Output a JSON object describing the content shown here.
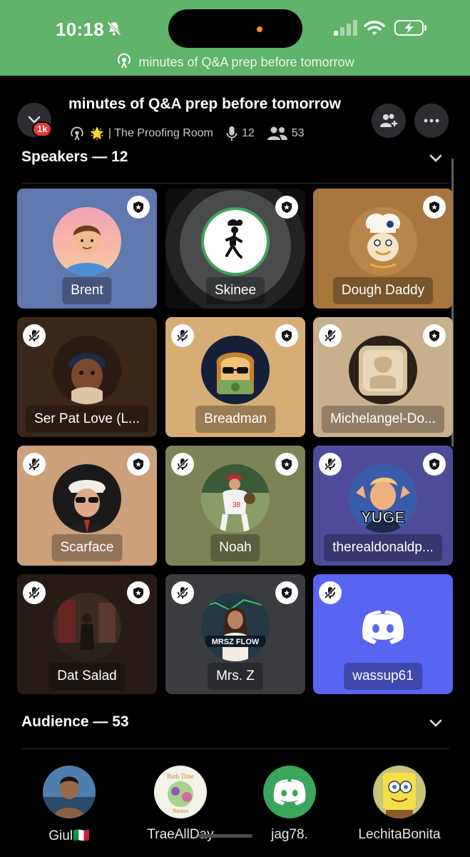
{
  "status_bar": {
    "time": "10:18",
    "banner_text": "minutes of Q&A prep before tomorrow",
    "background": "#5fb36a"
  },
  "header": {
    "badge": "1k",
    "title": "minutes of Q&A prep before tomorrow",
    "emoji": "🌟",
    "server": "| The Proofing Room",
    "speaker_count": "12",
    "listener_count": "53"
  },
  "speakers": {
    "heading": "Speakers — 12",
    "tiles": [
      {
        "name": "Brent",
        "bg": "#5f78ad",
        "avatar": "cartoon-man",
        "muted": false,
        "moderator": true
      },
      {
        "name": "Skinee",
        "bg": "#0e0f10",
        "avatar": "chef-stickman",
        "muted": false,
        "moderator": true,
        "speaking": true
      },
      {
        "name": "Dough Daddy",
        "bg": "#a8773e",
        "avatar": "dough-mascot",
        "muted": false,
        "moderator": true
      },
      {
        "name": "Ser Pat Love (L...",
        "bg": "#3a2719",
        "avatar": "painted-baby",
        "muted": true,
        "moderator": false
      },
      {
        "name": "Breadman",
        "bg": "#d6ad75",
        "avatar": "toast-sunglasses",
        "muted": true,
        "moderator": true
      },
      {
        "name": "Michelangel-Do...",
        "bg": "#c8b08e",
        "avatar": "carved-bread",
        "muted": true,
        "moderator": true
      },
      {
        "name": "Scarface",
        "bg": "#cba07b",
        "avatar": "gangster-baker",
        "muted": true,
        "moderator": true
      },
      {
        "name": "Noah",
        "bg": "#7d8356",
        "avatar": "baseball-pitcher",
        "muted": true,
        "moderator": false
      },
      {
        "name": "therealdonaldp...",
        "bg": "#4e4c9a",
        "avatar": "yuge-meme",
        "muted": true,
        "moderator": true
      },
      {
        "name": "Dat Salad",
        "bg": "#261c15",
        "avatar": "gym-selfie",
        "muted": true,
        "moderator": true
      },
      {
        "name": "Mrs. Z",
        "bg": "#3a3c40",
        "avatar": "mrsz-flow",
        "muted": true,
        "moderator": true
      },
      {
        "name": "wassup61",
        "bg": "#5865f2",
        "avatar": "discord-logo",
        "muted": true,
        "moderator": false
      }
    ]
  },
  "audience": {
    "heading": "Audience — 53",
    "members": [
      {
        "name": "Giul🇮🇹",
        "avatar": "man-beach"
      },
      {
        "name": "TraeAllDay",
        "avatar": "bath-time-art"
      },
      {
        "name": "jag78.",
        "avatar": "discord-logo-green"
      },
      {
        "name": "LechitaBonita",
        "avatar": "spongebob"
      }
    ]
  },
  "icons": {
    "stage": "stage-icon",
    "mic": "mic-icon",
    "people": "people-icon",
    "add_user": "add-user-icon",
    "more": "more-icon",
    "chevron": "chevron-down-icon",
    "moderator": "shield-star-icon",
    "muted": "mic-off-icon"
  }
}
